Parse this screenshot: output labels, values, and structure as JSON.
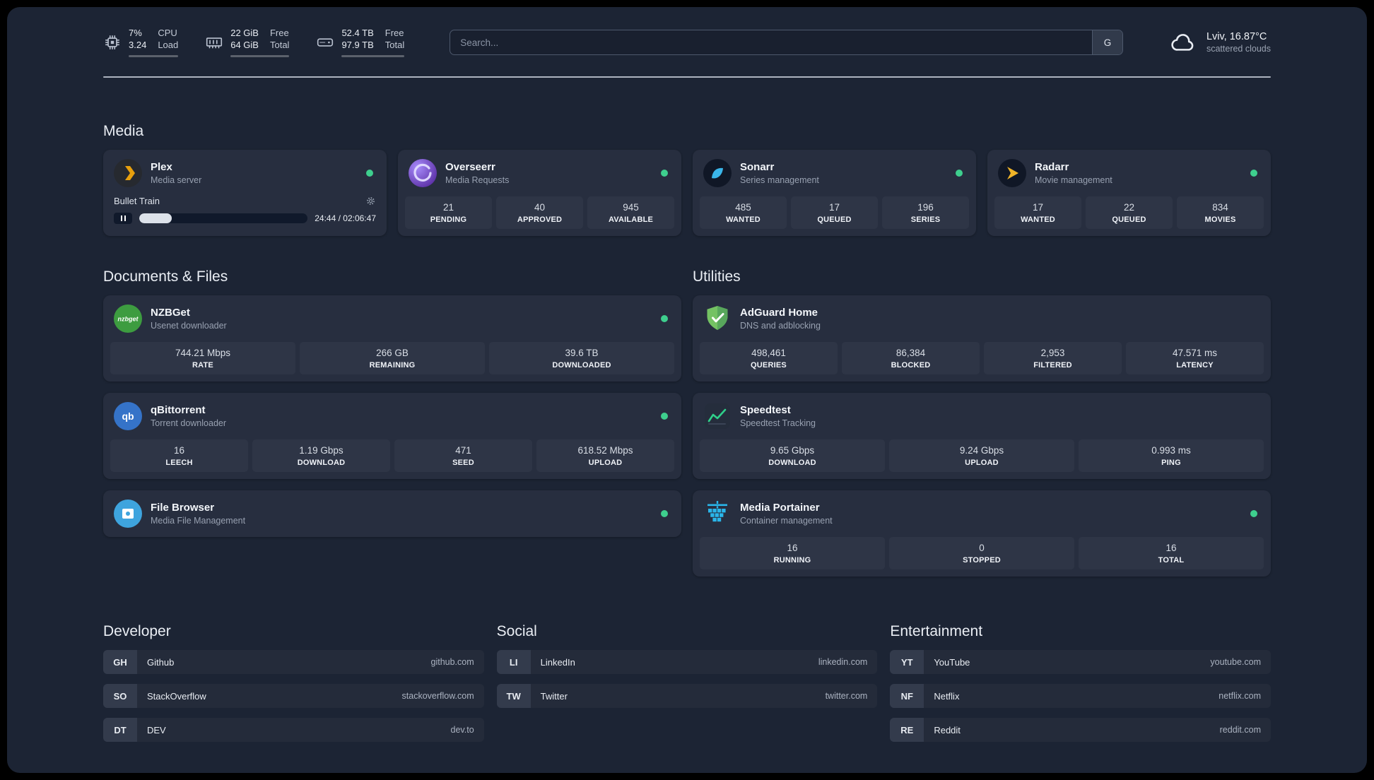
{
  "topbar": {
    "cpu": {
      "value1": "7%",
      "value2": "3.24",
      "label1": "CPU",
      "label2": "Load",
      "bar_pct": 7
    },
    "memory": {
      "value1": "22 GiB",
      "value2": "64 GiB",
      "label1": "Free",
      "label2": "Total",
      "bar_pct": 66
    },
    "disk": {
      "value1": "52.4 TB",
      "value2": "97.9 TB",
      "label1": "Free",
      "label2": "Total",
      "bar_pct": 47
    },
    "search": {
      "placeholder": "Search...",
      "button_label": "G"
    },
    "weather": {
      "location": "Lviv, 16.87°C",
      "condition": "scattered clouds"
    }
  },
  "icons": {
    "nzbget_label": "nzbget",
    "qbittorrent_label": "qb"
  },
  "sections": {
    "media": {
      "title": "Media",
      "plex": {
        "name": "Plex",
        "subtitle": "Media server",
        "player": {
          "title": "Bullet Train",
          "time": "24:44 / 02:06:47",
          "progress_pct": 19.5
        }
      },
      "overseerr": {
        "name": "Overseerr",
        "subtitle": "Media Requests",
        "stats": [
          {
            "value": "21",
            "label": "PENDING"
          },
          {
            "value": "40",
            "label": "APPROVED"
          },
          {
            "value": "945",
            "label": "AVAILABLE"
          }
        ]
      },
      "sonarr": {
        "name": "Sonarr",
        "subtitle": "Series management",
        "stats": [
          {
            "value": "485",
            "label": "WANTED"
          },
          {
            "value": "17",
            "label": "QUEUED"
          },
          {
            "value": "196",
            "label": "SERIES"
          }
        ]
      },
      "radarr": {
        "name": "Radarr",
        "subtitle": "Movie management",
        "stats": [
          {
            "value": "17",
            "label": "WANTED"
          },
          {
            "value": "22",
            "label": "QUEUED"
          },
          {
            "value": "834",
            "label": "MOVIES"
          }
        ]
      }
    },
    "documents": {
      "title": "Documents & Files",
      "nzbget": {
        "name": "NZBGet",
        "subtitle": "Usenet downloader",
        "stats": [
          {
            "value": "744.21 Mbps",
            "label": "RATE"
          },
          {
            "value": "266 GB",
            "label": "REMAINING"
          },
          {
            "value": "39.6 TB",
            "label": "DOWNLOADED"
          }
        ]
      },
      "qbittorrent": {
        "name": "qBittorrent",
        "subtitle": "Torrent downloader",
        "stats": [
          {
            "value": "16",
            "label": "LEECH"
          },
          {
            "value": "1.19 Gbps",
            "label": "DOWNLOAD"
          },
          {
            "value": "471",
            "label": "SEED"
          },
          {
            "value": "618.52 Mbps",
            "label": "UPLOAD"
          }
        ]
      },
      "filebrowser": {
        "name": "File Browser",
        "subtitle": "Media File Management"
      }
    },
    "utilities": {
      "title": "Utilities",
      "adguard": {
        "name": "AdGuard Home",
        "subtitle": "DNS and adblocking",
        "stats": [
          {
            "value": "498,461",
            "label": "QUERIES"
          },
          {
            "value": "86,384",
            "label": "BLOCKED"
          },
          {
            "value": "2,953",
            "label": "FILTERED"
          },
          {
            "value": "47.571 ms",
            "label": "LATENCY"
          }
        ]
      },
      "speedtest": {
        "name": "Speedtest",
        "subtitle": "Speedtest Tracking",
        "stats": [
          {
            "value": "9.65 Gbps",
            "label": "DOWNLOAD"
          },
          {
            "value": "9.24 Gbps",
            "label": "UPLOAD"
          },
          {
            "value": "0.993 ms",
            "label": "PING"
          }
        ]
      },
      "portainer": {
        "name": "Media Portainer",
        "subtitle": "Container management",
        "stats": [
          {
            "value": "16",
            "label": "RUNNING"
          },
          {
            "value": "0",
            "label": "STOPPED"
          },
          {
            "value": "16",
            "label": "TOTAL"
          }
        ]
      }
    },
    "bookmarks": {
      "developer": {
        "title": "Developer",
        "items": [
          {
            "abbr": "GH",
            "name": "Github",
            "url": "github.com"
          },
          {
            "abbr": "SO",
            "name": "StackOverflow",
            "url": "stackoverflow.com"
          },
          {
            "abbr": "DT",
            "name": "DEV",
            "url": "dev.to"
          }
        ]
      },
      "social": {
        "title": "Social",
        "items": [
          {
            "abbr": "LI",
            "name": "LinkedIn",
            "url": "linkedin.com"
          },
          {
            "abbr": "TW",
            "name": "Twitter",
            "url": "twitter.com"
          }
        ]
      },
      "entertainment": {
        "title": "Entertainment",
        "items": [
          {
            "abbr": "YT",
            "name": "YouTube",
            "url": "youtube.com"
          },
          {
            "abbr": "NF",
            "name": "Netflix",
            "url": "netflix.com"
          },
          {
            "abbr": "RE",
            "name": "Reddit",
            "url": "reddit.com"
          }
        ]
      }
    }
  }
}
